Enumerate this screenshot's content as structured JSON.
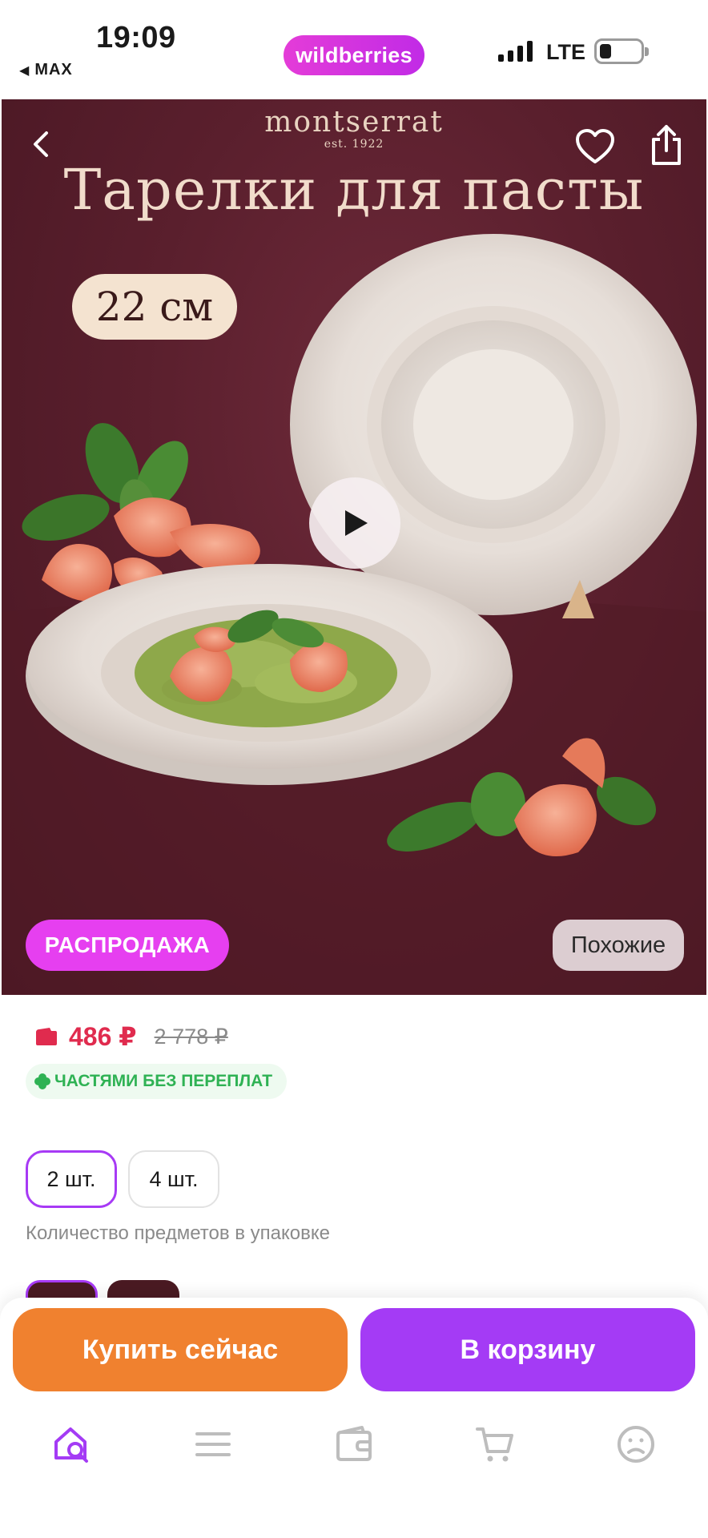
{
  "status_bar": {
    "time": "19:09",
    "back_app": "MAX",
    "brand": "wildberries",
    "network": "LTE"
  },
  "hero": {
    "brand_logo": "montserrat",
    "brand_est": "est. 1922",
    "title": "Тарелки для пасты",
    "size_label": "22 см",
    "sale_badge": "РАСПРОДАЖА",
    "similar_button": "Похожие"
  },
  "price": {
    "current": "486 ₽",
    "old": "2 778 ₽",
    "installment": "ЧАСТЯМИ БЕЗ ПЕРЕПЛАТ",
    "current_color": "#e02b4e",
    "installment_color": "#2fb254"
  },
  "quantity": {
    "options": [
      "2 шт.",
      "4 шт."
    ],
    "selected": "2 шт.",
    "caption": "Количество предметов в упаковке"
  },
  "actions": {
    "buy_now": "Купить сейчас",
    "add_to_cart": "В корзину",
    "buy_now_color": "#f0812f",
    "add_to_cart_color": "#a43bf5"
  },
  "tab_bar": {
    "items": [
      "home-search-icon",
      "catalog-icon",
      "wallet-icon",
      "cart-icon",
      "profile-icon"
    ],
    "active": "home-search-icon",
    "accent_color": "#a43bf5"
  }
}
